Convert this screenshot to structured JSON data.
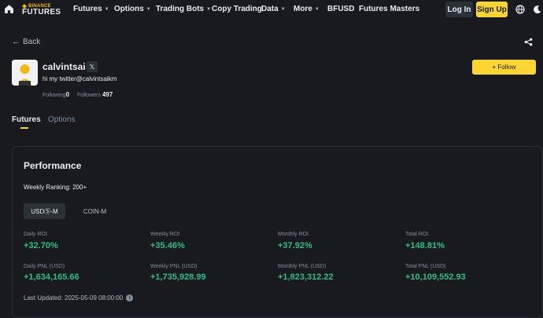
{
  "brand": {
    "top": "BINANCE",
    "bottom": "FUTURES"
  },
  "nav": [
    {
      "label": "Futures",
      "chevron": true
    },
    {
      "label": "Options",
      "chevron": true
    },
    {
      "label": "Trading Bots",
      "chevron": true
    },
    {
      "label": "Copy Trading",
      "chevron": false
    },
    {
      "label": "Data",
      "chevron": true
    },
    {
      "label": "More",
      "chevron": true
    },
    {
      "label": "BFUSD",
      "chevron": false
    },
    {
      "label": "Futures Masters",
      "chevron": false
    }
  ],
  "auth": {
    "login": "Log In",
    "signup": "Sign Up"
  },
  "back_label": "Back",
  "profile": {
    "username": "calvintsai",
    "x_badge": "𝕏",
    "bio": "hi my twitter@calvintsaikm",
    "following_label": "Following",
    "following": "0",
    "followers_label": "Followers",
    "followers": "497",
    "follow_button": "+ Follow"
  },
  "tabs": [
    {
      "label": "Futures",
      "active": true
    },
    {
      "label": "Options",
      "active": false
    }
  ],
  "performance": {
    "title": "Performance",
    "weekly_ranking": "Weekly Ranking: 200+",
    "segments": [
      "USDⓈ-M",
      "COIN-M"
    ],
    "metrics": [
      {
        "label": "Daily ROI",
        "value": "+32.70%"
      },
      {
        "label": "Weekly ROI",
        "value": "+35.46%"
      },
      {
        "label": "Monthly ROI",
        "value": "+37.92%"
      },
      {
        "label": "Total ROI",
        "value": "+148.81%"
      },
      {
        "label": "Daily PNL (USD)",
        "value": "+1,634,165.66"
      },
      {
        "label": "Weekly PNL (USD)",
        "value": "+1,735,928.99"
      },
      {
        "label": "Monthly PNL (USD)",
        "value": "+1,823,312.22"
      },
      {
        "label": "Total PNL (USD)",
        "value": "+10,109,552.93"
      }
    ],
    "last_updated": "Last Updated: 2025-05-09 08:00:00",
    "info_icon": "i"
  },
  "colors": {
    "accent": "#fcd535",
    "positive": "#2ebd85",
    "background": "#181a20"
  }
}
